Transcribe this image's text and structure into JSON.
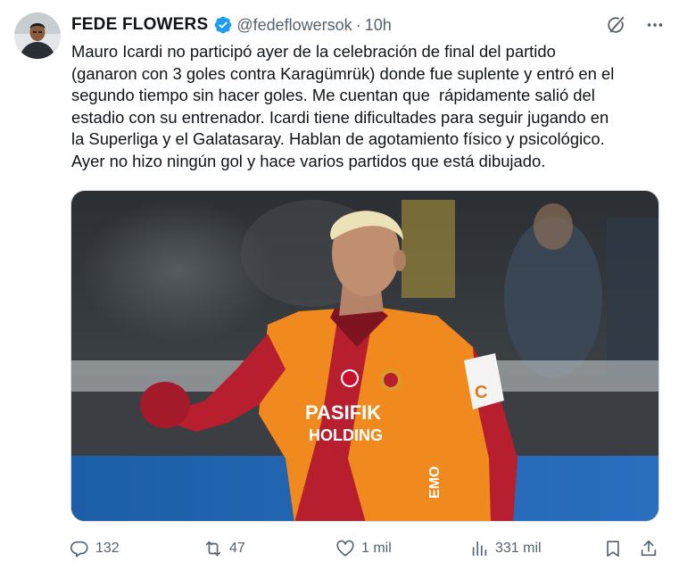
{
  "author": {
    "display_name": "FEDE FLOWERS",
    "handle": "@fedeflowersok",
    "separator": "·",
    "time": "10h",
    "verified_color": "#1d9bf0"
  },
  "tweet": {
    "text": "Mauro Icardi no participó ayer de la celebración de final del partido\n(ganaron con 3 goles contra Karagümrük) donde fue suplente y entró en el\nsegundo tiempo sin hacer goles. Me cuentan que  rápidamente salió del\nestadio con su entrenador. Icardi tiene dificultades para seguir jugando en\nla Superliga y el Galatasaray. Hablan de agotamiento físico y psicológico.\nAyer no hizo ningún gol y hace varios partidos que está dibujado."
  },
  "media": {
    "jersey_sponsor_line1": "PASIFIK",
    "jersey_sponsor_line2": "HOLDING",
    "jersey_sleeve_text": "EMO",
    "armband_letter": "C",
    "jersey_red": "#b81f2e",
    "jersey_orange": "#f08a1f"
  },
  "actions": {
    "replies": "132",
    "reposts": "47",
    "likes": "1 mil",
    "views": "331 mil"
  },
  "icons": {
    "header": [
      "verified-badge-icon",
      "grok-icon",
      "more-icon"
    ],
    "actions": [
      "reply-icon",
      "repost-icon",
      "like-icon",
      "views-icon",
      "bookmark-icon",
      "share-icon"
    ]
  },
  "colors": {
    "text": "#0f1419",
    "secondary": "#536471",
    "accent": "#1d9bf0"
  }
}
